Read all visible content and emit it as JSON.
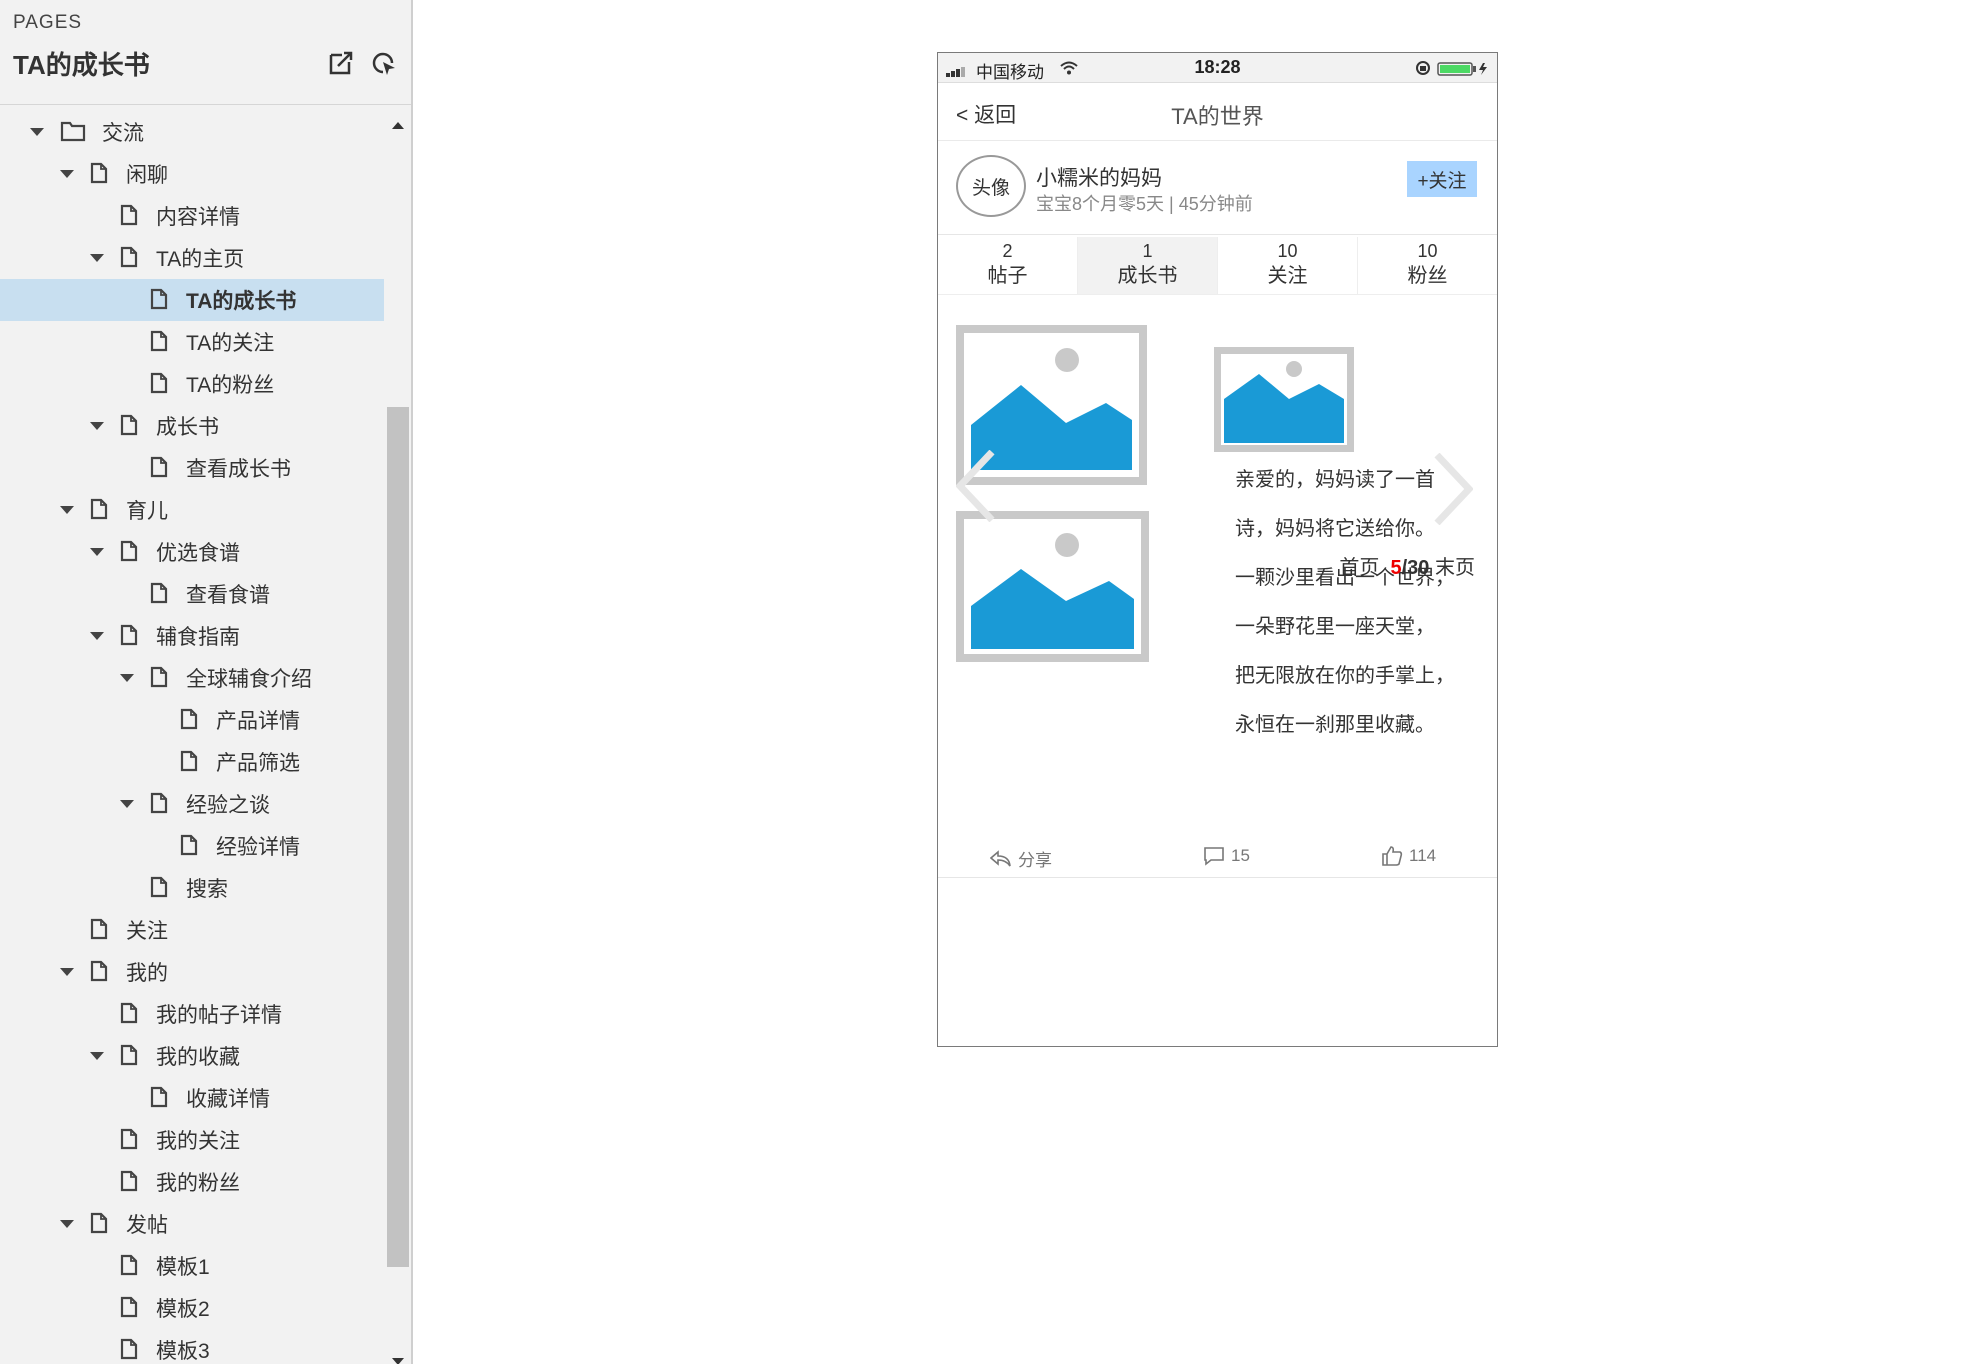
{
  "sidebar": {
    "pages_label": "PAGES",
    "title": "TA的成长书",
    "tree": [
      {
        "label": "交流",
        "level": 0,
        "expanded": true,
        "icon": "folder-icon"
      },
      {
        "label": "闲聊",
        "level": 1,
        "expanded": true,
        "icon": "page-icon"
      },
      {
        "label": "内容详情",
        "level": 2,
        "expanded": null,
        "icon": "page-icon"
      },
      {
        "label": "TA的主页",
        "level": 2,
        "expanded": true,
        "icon": "page-icon"
      },
      {
        "label": "TA的成长书",
        "level": 3,
        "expanded": null,
        "icon": "page-icon",
        "selected": true
      },
      {
        "label": "TA的关注",
        "level": 3,
        "expanded": null,
        "icon": "page-icon"
      },
      {
        "label": "TA的粉丝",
        "level": 3,
        "expanded": null,
        "icon": "page-icon"
      },
      {
        "label": "成长书",
        "level": 2,
        "expanded": true,
        "icon": "page-icon"
      },
      {
        "label": "查看成长书",
        "level": 3,
        "expanded": null,
        "icon": "page-icon"
      },
      {
        "label": "育儿",
        "level": 1,
        "expanded": true,
        "icon": "page-icon"
      },
      {
        "label": "优选食谱",
        "level": 2,
        "expanded": true,
        "icon": "page-icon"
      },
      {
        "label": "查看食谱",
        "level": 3,
        "expanded": null,
        "icon": "page-icon"
      },
      {
        "label": "辅食指南",
        "level": 2,
        "expanded": true,
        "icon": "page-icon"
      },
      {
        "label": "全球辅食介绍",
        "level": 3,
        "expanded": true,
        "icon": "page-icon"
      },
      {
        "label": "产品详情",
        "level": 4,
        "expanded": null,
        "icon": "page-icon"
      },
      {
        "label": "产品筛选",
        "level": 4,
        "expanded": null,
        "icon": "page-icon"
      },
      {
        "label": "经验之谈",
        "level": 3,
        "expanded": true,
        "icon": "page-icon"
      },
      {
        "label": "经验详情",
        "level": 4,
        "expanded": null,
        "icon": "page-icon"
      },
      {
        "label": "搜索",
        "level": 3,
        "expanded": null,
        "icon": "page-icon"
      },
      {
        "label": "关注",
        "level": 1,
        "expanded": null,
        "icon": "page-icon"
      },
      {
        "label": "我的",
        "level": 1,
        "expanded": true,
        "icon": "page-icon"
      },
      {
        "label": "我的帖子详情",
        "level": 2,
        "expanded": null,
        "icon": "page-icon"
      },
      {
        "label": "我的收藏",
        "level": 2,
        "expanded": true,
        "icon": "page-icon"
      },
      {
        "label": "收藏详情",
        "level": 3,
        "expanded": null,
        "icon": "page-icon"
      },
      {
        "label": "我的关注",
        "level": 2,
        "expanded": null,
        "icon": "page-icon"
      },
      {
        "label": "我的粉丝",
        "level": 2,
        "expanded": null,
        "icon": "page-icon"
      },
      {
        "label": "发帖",
        "level": 1,
        "expanded": true,
        "icon": "page-icon"
      },
      {
        "label": "模板1",
        "level": 2,
        "expanded": null,
        "icon": "page-icon"
      },
      {
        "label": "模板2",
        "level": 2,
        "expanded": null,
        "icon": "page-icon"
      },
      {
        "label": "模板3",
        "level": 2,
        "expanded": null,
        "icon": "page-icon"
      }
    ]
  },
  "phone": {
    "status": {
      "carrier": "中国移动",
      "time": "18:28"
    },
    "nav": {
      "back": "< 返回",
      "title": "TA的世界"
    },
    "profile": {
      "avatar": "头像",
      "name": "小糯米的妈妈",
      "meta": "宝宝8个月零5天 |  45分钟前",
      "follow": "+关注"
    },
    "stats": [
      {
        "num": "2",
        "label": "帖子",
        "active": false
      },
      {
        "num": "1",
        "label": "成长书",
        "active": true
      },
      {
        "num": "10",
        "label": "关注",
        "active": false
      },
      {
        "num": "10",
        "label": "粉丝",
        "active": false
      }
    ],
    "poem": [
      "亲爱的，妈妈读了一首",
      "诗，妈妈将它送给你。",
      "一颗沙里看出一个世界，",
      "一朵野花里一座天堂，",
      "把无限放在你的手掌上，",
      "永恒在一刹那里收藏。"
    ],
    "pager": {
      "first": "首页",
      "current": "5",
      "total": "/30",
      "last": "末页"
    },
    "actions": {
      "share": "分享",
      "comments": "15",
      "likes": "114"
    }
  },
  "colors": {
    "selected_row": "#c8dff0",
    "follow_button": "#a9d4ff",
    "image_blue": "#1a9ad6",
    "pager_current": "#e00000"
  }
}
